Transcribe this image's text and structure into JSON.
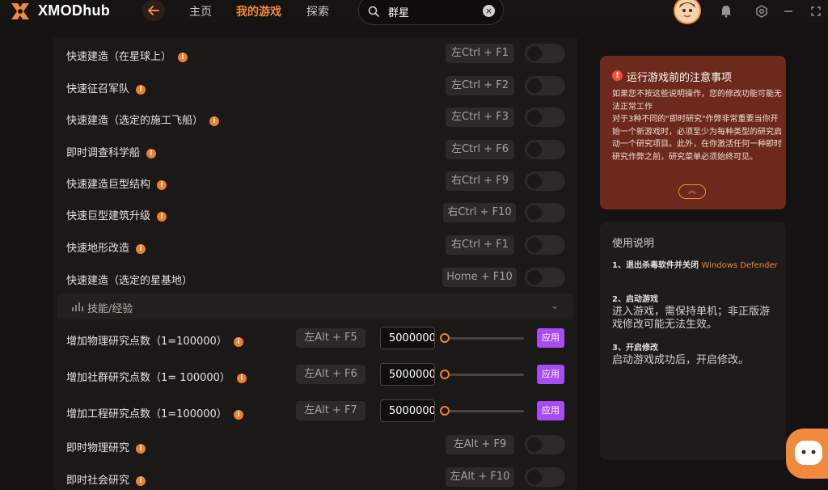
{
  "app": {
    "brand": "XMODhub"
  },
  "nav": {
    "home": "主页",
    "my_games": "我的游戏",
    "explore": "探索"
  },
  "search": {
    "value": "群星",
    "clear": "×"
  },
  "colors": {
    "accent": "#f08a3c",
    "apply": "#a74bf2",
    "notice_bg": "#6d2a1c",
    "background": "#141212"
  },
  "icons": {
    "logo": "xmod-logo-icon",
    "back": "back-arrow-icon",
    "search": "search-icon",
    "bell": "notification-icon",
    "settings": "settings-icon",
    "minimize": "minimize-icon",
    "fullscreen": "fullscreen-icon",
    "chat": "assistant-bubble-icon"
  },
  "cheats": [
    {
      "label": "快速建造（在星球上）",
      "hotkey": "左Ctrl + F1",
      "enabled": false
    },
    {
      "label": "快速征召军队",
      "hotkey": "左Ctrl + F2",
      "enabled": false
    },
    {
      "label": "快速建造（选定的施工飞船）",
      "hotkey": "左Ctrl + F3",
      "enabled": false
    },
    {
      "label": "即时调查科学船",
      "hotkey": "左Ctrl + F6",
      "enabled": false
    },
    {
      "label": "快速建造巨型结构",
      "hotkey": "右Ctrl + F9",
      "enabled": false
    },
    {
      "label": "快速巨型建筑升级",
      "hotkey": "右Ctrl + F10",
      "enabled": false
    },
    {
      "label": "快速地形改造",
      "hotkey": "右Ctrl + F1",
      "enabled": false
    },
    {
      "label": "快速建造（选定的星基地）",
      "hotkey": "Home + F10",
      "enabled": false
    }
  ],
  "section": {
    "title": "技能/经验",
    "chevron": "⌄"
  },
  "value_cheats": [
    {
      "label": "增加物理研究点数（1=100000）",
      "hotkey": "左Alt + F5",
      "value": "5000000",
      "slider": 0.0,
      "apply": "应用"
    },
    {
      "label": "增加社群研究点数（1= 100000）",
      "hotkey": "左Alt + F6",
      "value": "5000000",
      "slider": 0.0,
      "apply": "应用"
    },
    {
      "label": "增加工程研究点数（1=100000）",
      "hotkey": "左Alt + F7",
      "value": "5000000",
      "slider": 0.0,
      "apply": "应用"
    }
  ],
  "cheats2": [
    {
      "label": "即时物理研究",
      "hotkey": "左Alt + F9",
      "enabled": false
    },
    {
      "label": "即时社会研究",
      "hotkey": "左Alt + F10",
      "enabled": false
    }
  ],
  "info_glyph": "i",
  "notice": {
    "icon": "!",
    "title": "运行游戏前的注意事项",
    "body": "如果您不按这些说明操作，您的修改功能可能无法正常工作\n对于3种不同的\"即时研究\"作弊非常重要当你开始一个新游戏时，必须至少为每种类型的研究启动一个研究项目。此外，在你激活任何一种即时研究作弊之前，研究菜单必须始终可见。",
    "collapse": "︽"
  },
  "usage": {
    "title": "使用说明",
    "steps": [
      {
        "head": "1、退出杀毒软件并关闭",
        "head_accent": "Windows Defender",
        "body": ""
      },
      {
        "head": "2、启动游戏",
        "head_accent": "",
        "body": "进入游戏，需保持单机；非正版游戏修改可能无法生效。"
      },
      {
        "head": "3、开启修改",
        "head_accent": "",
        "body": "启动游戏成功后，开启修改。"
      }
    ]
  }
}
